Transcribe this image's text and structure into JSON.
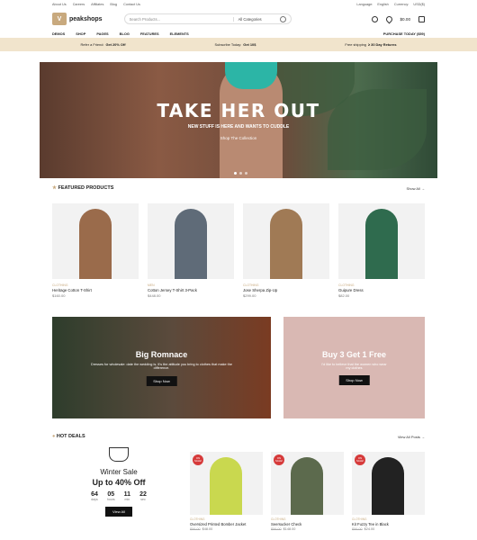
{
  "topbar": {
    "links": [
      "About Us",
      "Careers",
      "Affiliates",
      "Blog",
      "Contact Us"
    ],
    "language_label": "Language:",
    "language_value": "English",
    "currency_label": "Currency:",
    "currency_value": "USD($)"
  },
  "header": {
    "logo_text": "peakshops",
    "search_placeholder": "Search Products...",
    "category_select": "All Categories",
    "cart_total": "$0.00",
    "cart_count": "0"
  },
  "nav": {
    "items": [
      "DEMOS",
      "SHOP",
      "PAGES",
      "BLOG",
      "FEATURES",
      "ELEMENTS"
    ],
    "purchase_label": "PURCHASE TODAY ($59)"
  },
  "promo": {
    "items": [
      {
        "text": "Refer a Friend:",
        "bold": "Get 20% Off"
      },
      {
        "text": "Subscribe Today:",
        "bold": "Get 10$"
      },
      {
        "text": "Free shipping",
        "bold": "≥ 30 Day Returns"
      }
    ]
  },
  "hero": {
    "title": "TAKE HER OUT",
    "subtitle": "NEW STUFF IS HERE AND WANTS TO CUDDLE",
    "cta": "Shop The Collection"
  },
  "featured": {
    "title": "FEATURED PRODUCTS",
    "view_all": "Show All",
    "products": [
      {
        "category": "CLOTHING",
        "name": "Heritage Cotton T-Shirt",
        "price": "$160.00",
        "color": "#9a6b4b"
      },
      {
        "category": "MEN",
        "name": "Cotton Jersey T-Shirt 3-Pack",
        "price": "$448.00",
        "color": "#5f6b78"
      },
      {
        "category": "CLOTHING",
        "name": "Jose Sherpa Zip-Up",
        "price": "$299.00",
        "color": "#a07a55"
      },
      {
        "category": "CLOTHING",
        "name": "Guipure Dress",
        "price": "$82.00",
        "color": "#2f6b4e"
      }
    ]
  },
  "banners": [
    {
      "title": "Big Romnace",
      "text": "Dresses for wholesale: date the wedding is. It's the attitude you bring to clothes that make the difference.",
      "button": "Shop Now"
    },
    {
      "title": "Buy 3 Get 1 Free",
      "text": "I'd like to believe that the women who wear my clothes",
      "button": "Shop Now"
    }
  ],
  "hot_deals": {
    "title": "HOT DEALS",
    "view_all": "View All Posts",
    "countdown": {
      "title": "Winter Sale",
      "subtitle": "Up to 40% Off",
      "days": "64",
      "days_label": "days",
      "hours": "05",
      "hours_label": "hours",
      "mins": "11",
      "mins_label": "min",
      "secs": "22",
      "secs_label": "sec",
      "button": "View All"
    },
    "items": [
      {
        "badge": "ON SALE!",
        "category": "CLOTHING",
        "name": "Oversized Printed Bomber Jacket",
        "old_price": "$56.00",
        "price": "$48.00",
        "color": "#c9d84f"
      },
      {
        "badge": "ON SALE!",
        "category": "CLOTHING",
        "name": "Seersucker Check",
        "old_price": "$56.00",
        "price": "$148.00",
        "color": "#5c6a4d"
      },
      {
        "badge": "ON SALE!",
        "category": "CLOTHING",
        "name": "Kit Fuzzy Tee in Black",
        "old_price": "$56.00",
        "price": "$24.00",
        "color": "#222222"
      }
    ]
  }
}
